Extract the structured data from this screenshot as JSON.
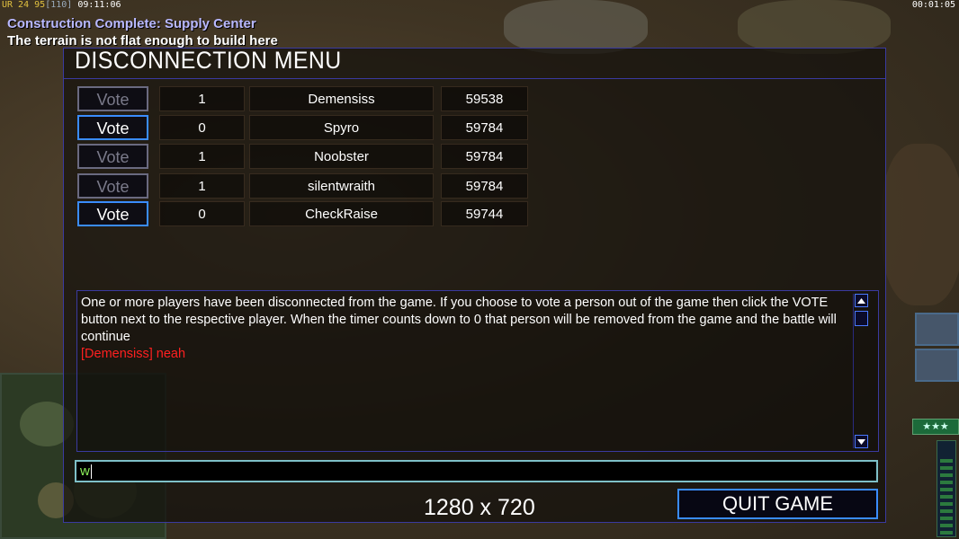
{
  "hud": {
    "prefix": "UR 24",
    "stat": "95",
    "bracket": "[110]",
    "clock": "09:11:06",
    "timer": "00:01:05"
  },
  "messages": [
    "Construction Complete: Supply Center",
    "The terrain is not flat enough to build here"
  ],
  "menu": {
    "title": "DISCONNECTION MENU",
    "vote_label": "Vote",
    "players": [
      {
        "votes": "1",
        "name": "Demensiss",
        "ping": "59538",
        "vote_enabled": false
      },
      {
        "votes": "0",
        "name": "Spyro",
        "ping": "59784",
        "vote_enabled": true
      },
      {
        "votes": "1",
        "name": "Noobster",
        "ping": "59784",
        "vote_enabled": false
      },
      {
        "votes": "1",
        "name": "silentwraith",
        "ping": "59784",
        "vote_enabled": false
      },
      {
        "votes": "0",
        "name": "CheckRaise",
        "ping": "59744",
        "vote_enabled": true
      }
    ],
    "chat": {
      "system_message": "One or more players have been disconnected from the game. If you choose to vote a person out of the game then click the VOTE button next to the respective player. When the timer counts down to 0 that person will be removed from the game and the battle will continue",
      "player_message": "[Demensiss] neah"
    },
    "input_value": "w",
    "resolution_label": "1280 x 720",
    "quit_label": "QUIT GAME"
  },
  "rank": {
    "label": "★★★"
  },
  "colors": {
    "panel_border": "#3a3aa0",
    "button_active": "#3a8cff",
    "button_disabled": "#6a6a80",
    "chat_red": "#ff2020",
    "input_border": "#7ec0c8"
  }
}
